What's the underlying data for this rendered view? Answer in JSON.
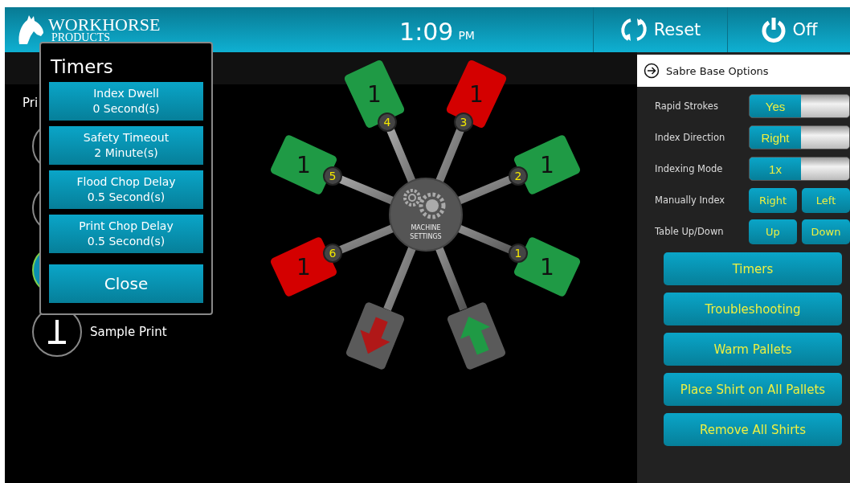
{
  "header": {
    "logo": {
      "line_1": "WORKHORSE",
      "line_2": "PRODUCTS"
    },
    "clock": {
      "time": "1:09",
      "period": "PM"
    },
    "actions": [
      {
        "kind": "reset",
        "label": "Reset"
      },
      {
        "kind": "power",
        "label": "Off"
      }
    ]
  },
  "left_menu": {
    "heading": "Pri",
    "items": [
      {
        "kind": "plain",
        "selected": false
      },
      {
        "kind": "plain",
        "selected": false
      },
      {
        "kind": "plain",
        "selected": true
      },
      {
        "kind": "sample",
        "selected": false,
        "label": "Sample Print"
      }
    ]
  },
  "wheel": {
    "hub_lines": [
      "MACHINE",
      "SETTINGS"
    ],
    "stations": [
      {
        "kind": "pallet",
        "number": "4",
        "count": "1",
        "color": "#1f9a45"
      },
      {
        "kind": "pallet",
        "number": "3",
        "count": "1",
        "color": "#d40000"
      },
      {
        "kind": "pallet",
        "number": "5",
        "count": "1",
        "color": "#1f9a45"
      },
      {
        "kind": "pallet",
        "number": "2",
        "count": "1",
        "color": "#1f9a45"
      },
      {
        "kind": "pallet",
        "number": "6",
        "count": "1",
        "color": "#d40000"
      },
      {
        "kind": "pallet",
        "number": "1",
        "count": "1",
        "color": "#1f9a45"
      },
      {
        "kind": "unload"
      },
      {
        "kind": "load"
      }
    ]
  },
  "timers_dialog": {
    "title": "Timers",
    "timers": [
      {
        "label": "Index Dwell",
        "value": "0 Second(s)"
      },
      {
        "label": "Safety Timeout",
        "value": "2 Minute(s)"
      },
      {
        "label": "Flood Chop Delay",
        "value": "0.5 Second(s)"
      },
      {
        "label": "Print Chop Delay",
        "value": "0.5 Second(s)"
      }
    ],
    "close": "Close"
  },
  "options_panel": {
    "title": "Sabre Base Options",
    "settings": [
      {
        "kind": "toggle",
        "label": "Rapid Strokes",
        "value": "Yes",
        "on": true
      },
      {
        "kind": "toggle",
        "label": "Index Direction",
        "value": "Right",
        "on": true
      },
      {
        "kind": "toggle",
        "label": "Indexing Mode",
        "value": "1x",
        "on": true
      },
      {
        "kind": "buttons",
        "label": "Manually Index",
        "buttons": [
          "Right",
          "Left"
        ]
      },
      {
        "kind": "buttons",
        "label": "Table Up/Down",
        "buttons": [
          "Up",
          "Down"
        ]
      }
    ],
    "actions": [
      "Timers",
      "Troubleshooting",
      "Warm Pallets",
      "Place Shirt on All Pallets",
      "Remove All Shirts"
    ]
  }
}
